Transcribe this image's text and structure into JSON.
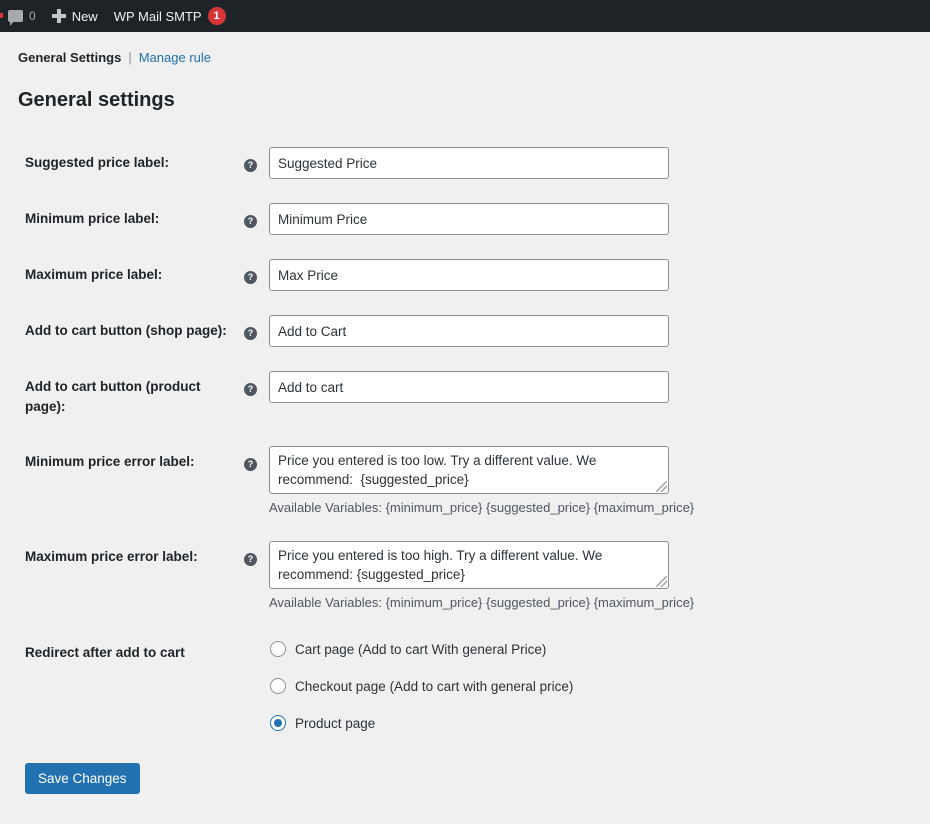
{
  "adminbar": {
    "comments_icon": "comment-bubble-icon",
    "comments_count": "0",
    "new_icon": "plus-icon",
    "new_label": "New",
    "smtp_label": "WP Mail SMTP",
    "smtp_badge": "1",
    "badge_color": "#d63638",
    "background": "#1d2327"
  },
  "subnav": {
    "current": "General Settings",
    "separator": "|",
    "link": "Manage rule",
    "link_color": "#2271b1"
  },
  "page": {
    "title": "General settings",
    "background": "#f0f0f1",
    "accent": "#2271b1"
  },
  "help_icon_glyph": "?",
  "fields": [
    {
      "label": "Suggested price label:",
      "help": "help-icon",
      "type": "text",
      "value": "Suggested Price",
      "placeholder": "Suggested Price"
    },
    {
      "label": "Minimum price label:",
      "help": "help-icon",
      "type": "text",
      "value": "Minimum Price",
      "placeholder": "Minimum Price"
    },
    {
      "label": "Maximum price label:",
      "help": "help-icon",
      "type": "text",
      "value": "Max Price",
      "placeholder": "Max Price"
    },
    {
      "label": "Add to cart button (shop page):",
      "help": "help-icon",
      "type": "text",
      "value": "Add to Cart",
      "placeholder": "Add to Cart"
    },
    {
      "label": "Add to cart button (product page):",
      "help": "help-icon",
      "type": "text",
      "value": "Add to cart",
      "placeholder": "Add to cart"
    },
    {
      "label": "Minimum price error label:",
      "help": "help-icon",
      "type": "textarea",
      "value": "Price you entered is too low. Try a different value. We recommend:  {suggested_price}",
      "placeholder": "Price you entered is too low. Try a different value. We recommend:  {suggested_price}",
      "helper": "Available Variables: {minimum_price} {suggested_price} {maximum_price}"
    },
    {
      "label": "Maximum price error label:",
      "help": "help-icon",
      "type": "textarea",
      "value": "Price you entered is too high. Try a different value. We recommend: {suggested_price}",
      "placeholder": "Price you entered is too high. Try a different value. We recommend: {suggested_price}",
      "helper": "Available Variables: {minimum_price} {suggested_price} {maximum_price}"
    }
  ],
  "redirect": {
    "label": "Redirect after add to cart",
    "options": [
      {
        "label": "Cart page (Add to cart With general Price)",
        "checked": false
      },
      {
        "label": "Checkout page (Add to cart with general price)",
        "checked": false
      },
      {
        "label": "Product page",
        "checked": true
      }
    ]
  },
  "save_label": "Save Changes"
}
